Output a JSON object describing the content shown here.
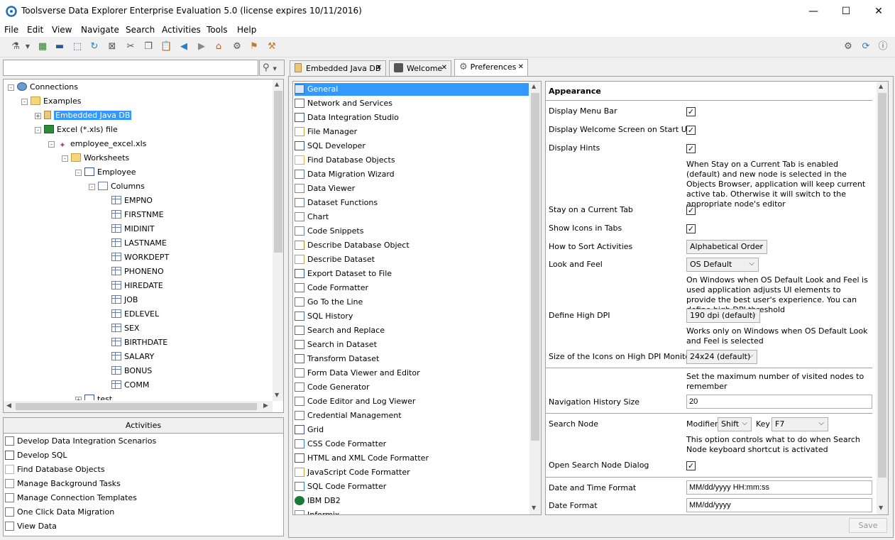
{
  "window": {
    "title": "Toolsverse Data Explorer Enterprise Evaluation 5.0 (license expires 10/11/2016)",
    "minimize": "—",
    "maximize": "☐",
    "close": "✕"
  },
  "menu": [
    "File",
    "Edit",
    "View",
    "Navigate",
    "Search",
    "Activities",
    "Tools",
    "Help"
  ],
  "search": {
    "value": "",
    "icon": "magnifier-icon"
  },
  "tree": {
    "items": [
      {
        "label": "Connections",
        "icon": "globe-icon",
        "depth": 0,
        "exp": "-"
      },
      {
        "label": "Examples",
        "icon": "folder-icon",
        "depth": 1,
        "exp": "-"
      },
      {
        "label": "Embedded Java DB",
        "icon": "database-icon",
        "depth": 2,
        "exp": "+",
        "selected": true
      },
      {
        "label": "Excel (*.xls) file",
        "icon": "excel-icon",
        "depth": 2,
        "exp": "-"
      },
      {
        "label": "employee_excel.xls",
        "icon": "file-icon",
        "depth": 3,
        "exp": "-"
      },
      {
        "label": "Worksheets",
        "icon": "folder-icon",
        "depth": 4,
        "exp": "-"
      },
      {
        "label": "Employee",
        "icon": "table-icon",
        "depth": 5,
        "exp": "-"
      },
      {
        "label": "Columns",
        "icon": "columns-icon",
        "depth": 6,
        "exp": "-"
      },
      {
        "label": "EMPNO",
        "icon": "column-icon",
        "depth": 7
      },
      {
        "label": "FIRSTNME",
        "icon": "column-icon",
        "depth": 7
      },
      {
        "label": "MIDINIT",
        "icon": "column-icon",
        "depth": 7
      },
      {
        "label": "LASTNAME",
        "icon": "column-icon",
        "depth": 7
      },
      {
        "label": "WORKDEPT",
        "icon": "column-icon",
        "depth": 7
      },
      {
        "label": "PHONENO",
        "icon": "column-icon",
        "depth": 7
      },
      {
        "label": "HIREDATE",
        "icon": "column-icon",
        "depth": 7
      },
      {
        "label": "JOB",
        "icon": "column-icon",
        "depth": 7
      },
      {
        "label": "EDLEVEL",
        "icon": "column-icon",
        "depth": 7
      },
      {
        "label": "SEX",
        "icon": "column-icon",
        "depth": 7
      },
      {
        "label": "BIRTHDATE",
        "icon": "column-icon",
        "depth": 7
      },
      {
        "label": "SALARY",
        "icon": "column-icon",
        "depth": 7
      },
      {
        "label": "BONUS",
        "icon": "column-icon",
        "depth": 7
      },
      {
        "label": "COMM",
        "icon": "column-icon",
        "depth": 7
      },
      {
        "label": "test",
        "icon": "table-icon",
        "depth": 5,
        "exp": "+"
      }
    ]
  },
  "activities": {
    "title": "Activities",
    "items": [
      {
        "label": "Develop Data Integration Scenarios",
        "icon": "integration-icon"
      },
      {
        "label": "Develop SQL",
        "icon": "sql-icon"
      },
      {
        "label": "Find Database Objects",
        "icon": "find-db-icon"
      },
      {
        "label": "Manage Background Tasks",
        "icon": "tasks-icon"
      },
      {
        "label": "Manage Connection Templates",
        "icon": "templates-icon"
      },
      {
        "label": "One Click Data Migration",
        "icon": "migration-icon"
      },
      {
        "label": "View Data",
        "icon": "grid-icon"
      }
    ]
  },
  "tabs": [
    {
      "label": "Embedded Java DB",
      "icon": "database-icon",
      "close": "✕"
    },
    {
      "label": "Welcome",
      "icon": "welcome-icon",
      "close": "✕"
    },
    {
      "label": "Preferences",
      "icon": "gear-icon",
      "close": "✕",
      "active": true
    }
  ],
  "pref_categories": [
    "General",
    "Network and Services",
    "Data Integration Studio",
    "File Manager",
    "SQL Developer",
    "Find Database Objects",
    "Data Migration Wizard",
    "Data Viewer",
    "Dataset Functions",
    "Chart",
    "Code Snippets",
    "Describe Database Object",
    "Describe Dataset",
    "Export Dataset to File",
    "Code Formatter",
    "Go To the Line",
    "SQL History",
    "Search and Replace",
    "Search in Dataset",
    "Transform Dataset",
    "Form Data Viewer and Editor",
    "Code Generator",
    "Code Editor and Log Viewer",
    "Credential Management",
    "Grid",
    "CSS Code Formatter",
    "HTML and XML Code Formatter",
    "JavaScript Code Formatter",
    "SQL Code Formatter",
    "IBM DB2",
    "Informix"
  ],
  "prefs": {
    "section": "Appearance",
    "display_menu_bar": "Display Menu Bar",
    "display_welcome": "Display Welcome Screen on Start Up",
    "display_hints": "Display Hints",
    "hint_stay": "When Stay on a Current Tab is enabled (default) and new node is selected in the Objects Browser, application will keep current active tab. Otherwise it will switch to the appropriate node's editor",
    "stay_tab": "Stay on a Current Tab",
    "show_icons": "Show Icons in Tabs",
    "sort_label": "How to Sort Activities",
    "sort_value": "Alphabetical Order",
    "laf_label": "Look and Feel",
    "laf_value": "OS Default",
    "hint_laf": "On Windows when OS Default Look and Feel is used application adjusts UI elements to provide the best user's experience. You can define high DPI threshold",
    "dpi_label": "Define High DPI",
    "dpi_value": "190 dpi (default)",
    "hint_dpi": "Works only on Windows when OS Default Look and Feel is selected",
    "icon_size_label": "Size of the Icons on High DPI Monitors",
    "icon_size_value": "24x24 (default)",
    "hint_nav": "Set the maximum number of visited nodes to remember",
    "nav_label": "Navigation History Size",
    "nav_value": "20",
    "search_label": "Search Node",
    "modifier_label": "Modifier",
    "modifier_value": "Shift",
    "key_label": "Key",
    "key_value": "F7",
    "hint_search": "This option controls what to do when Search Node keyboard shortcut is activated",
    "open_search_label": "Open Search Node Dialog",
    "dt_label": "Date and Time Format",
    "dt_value": "MM/dd/yyyy HH:mm:ss",
    "date_label": "Date Format",
    "date_value": "MM/dd/yyyy",
    "check": "✓",
    "chevron": "⌵"
  },
  "save": "Save"
}
